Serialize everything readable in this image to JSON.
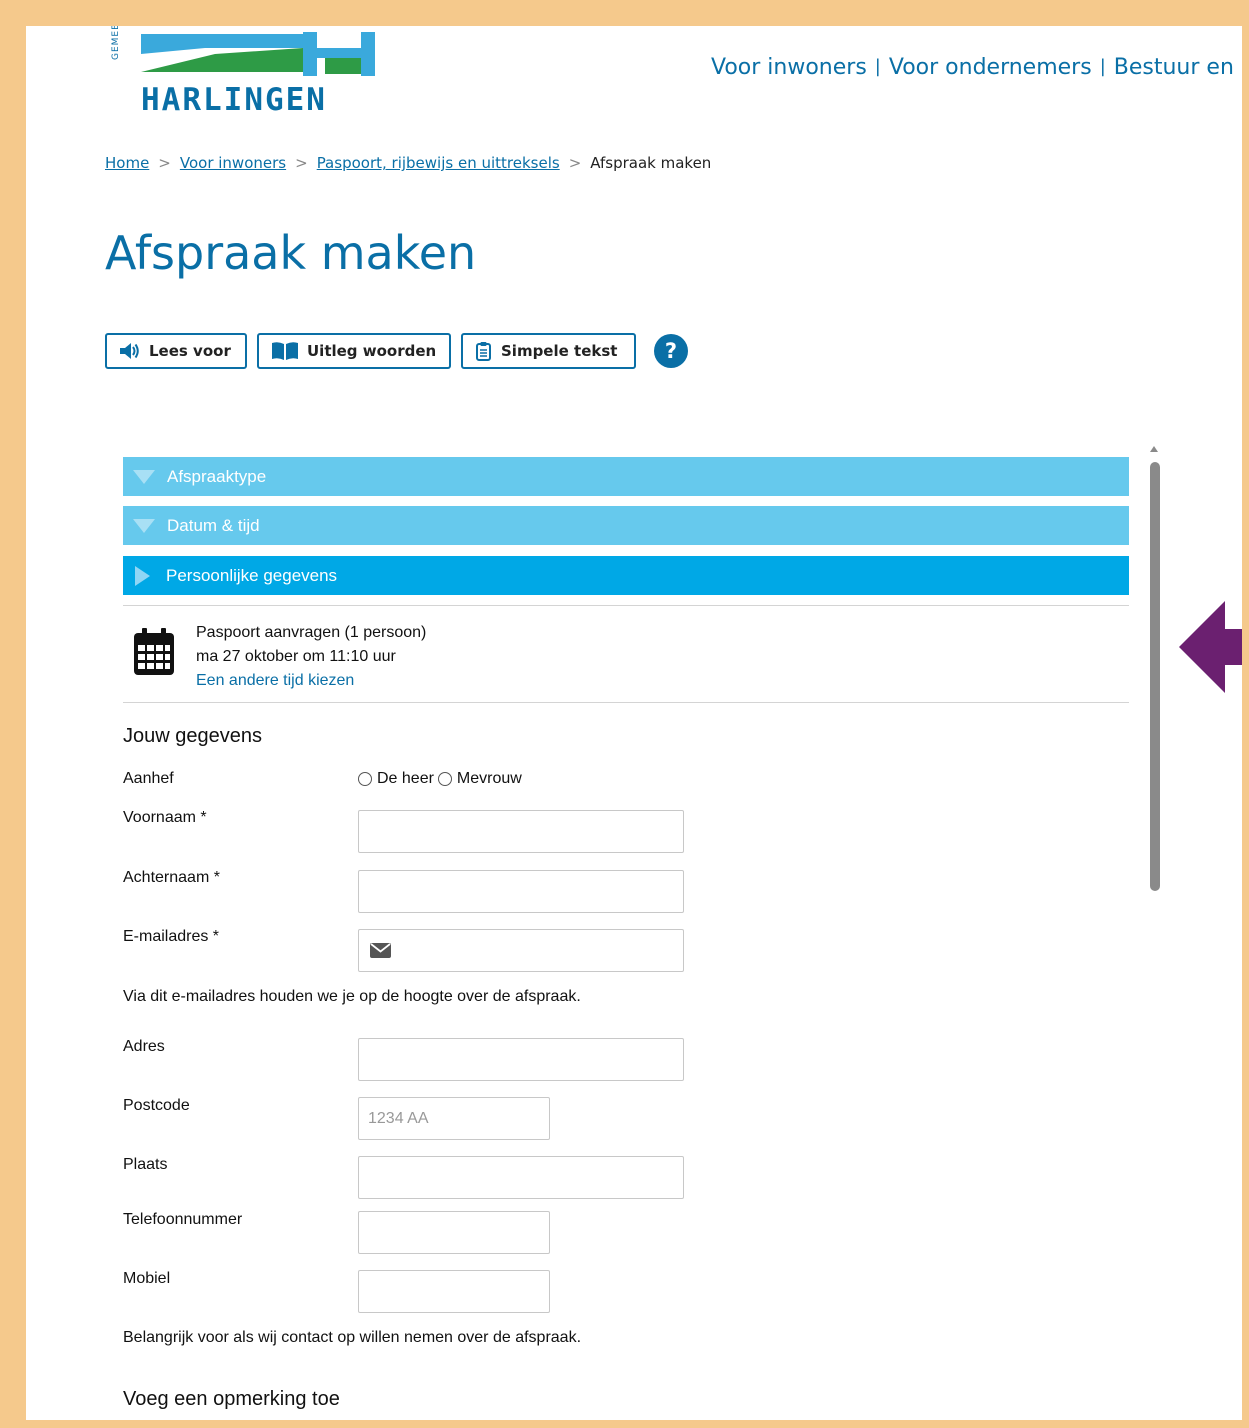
{
  "logo": {
    "word": "HARLINGEN",
    "vertical": "GEMEENTE"
  },
  "topnav": [
    "Voor inwoners",
    "Voor ondernemers",
    "Bestuur en"
  ],
  "breadcrumb": {
    "home": "Home",
    "inwoners": "Voor inwoners",
    "paspoort": "Paspoort, rijbewijs en uittreksels",
    "current": "Afspraak maken"
  },
  "page_title": "Afspraak maken",
  "toolbar": {
    "read_aloud": "Lees voor",
    "explain_words": "Uitleg woorden",
    "simple_text": "Simpele tekst",
    "help": "?"
  },
  "steps": {
    "type": "Afspraaktype",
    "datetime": "Datum & tijd",
    "personal": "Persoonlijke gegevens"
  },
  "summary": {
    "product": "Paspoort aanvragen (1 persoon)",
    "when": "ma 27 oktober om 11:10 uur",
    "change_link": "Een andere tijd kiezen"
  },
  "form": {
    "section_title": "Jouw gegevens",
    "aanhef_label": "Aanhef",
    "option_heer": "De heer",
    "option_mevrouw": "Mevrouw",
    "voornaam_label": "Voornaam *",
    "achternaam_label": "Achternaam *",
    "email_label": "E-mailadres *",
    "email_note": "Via dit e-mailadres houden we je op de hoogte over de afspraak.",
    "adres_label": "Adres",
    "postcode_label": "Postcode",
    "postcode_placeholder": "1234 AA",
    "plaats_label": "Plaats",
    "telefoon_label": "Telefoonnummer",
    "mobiel_label": "Mobiel",
    "phone_note": "Belangrijk voor als wij contact op willen nemen over de afspraak.",
    "remark_title": "Voeg een opmerking toe"
  },
  "colors": {
    "brand_blue": "#0a6fa6",
    "step_closed": "#66c9ed",
    "step_active": "#00a8e6",
    "logo_green": "#2e9b46",
    "logo_light_blue": "#3aa9dc",
    "arrow_purple": "#6b2070",
    "border_peach": "#f5c98c"
  }
}
